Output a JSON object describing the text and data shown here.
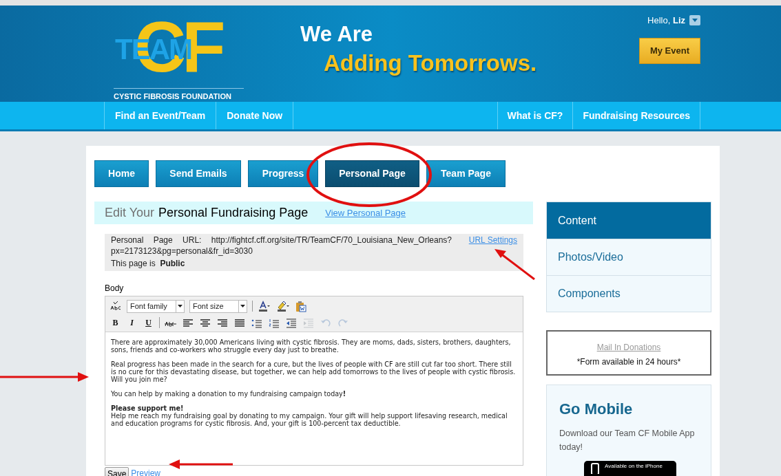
{
  "header": {
    "logo": {
      "team": "TEAM",
      "cf": "CF",
      "foundation": "CYSTIC FIBROSIS FOUNDATION"
    },
    "tagline_1": "We Are",
    "tagline_2": "Adding Tomorrows.",
    "greeting": "Hello,",
    "user": "Liz",
    "my_event_button": "My Event"
  },
  "nav": {
    "left": [
      "Find an Event/Team",
      "Donate Now"
    ],
    "right": [
      "What is CF?",
      "Fundraising Resources"
    ]
  },
  "tabs": [
    {
      "label": "Home",
      "selected": false,
      "circled": false
    },
    {
      "label": "Send Emails",
      "selected": false,
      "circled": false
    },
    {
      "label": "Progress",
      "selected": false,
      "circled": false
    },
    {
      "label": "Personal Page",
      "selected": true,
      "circled": true
    },
    {
      "label": "Team Page",
      "selected": false,
      "circled": false
    }
  ],
  "editor_page": {
    "heading_prefix": "Edit Your",
    "heading": "Personal Fundraising Page",
    "view_link": "View Personal Page",
    "url_label": "Personal Page URL:",
    "url": "http://fightcf.cff.org/site/TR/TeamCF/70_Louisiana_New_Orleans?px=2173123&pg=personal&fr_id=3030",
    "url_settings_link": "URL Settings",
    "url_settings_arrow": true,
    "body_arrow": true,
    "preview_arrow": true,
    "visibility_label": "This page is",
    "visibility": "Public",
    "body_label": "Body",
    "toolbar_1": [
      {
        "kind": "spellcheck",
        "disabled": false
      },
      {
        "kind": "select",
        "label": "Font family"
      },
      {
        "kind": "select",
        "label": "Font size"
      },
      {
        "kind": "separator"
      },
      {
        "kind": "font-color"
      },
      {
        "kind": "highlight"
      },
      {
        "kind": "paste-word"
      }
    ],
    "toolbar_2": [
      {
        "kind": "bold",
        "label": "B",
        "disabled": false
      },
      {
        "kind": "italic",
        "label": "I",
        "disabled": false
      },
      {
        "kind": "underline",
        "label": "U",
        "disabled": false
      },
      {
        "kind": "separator"
      },
      {
        "kind": "strikethrough",
        "disabled": false
      },
      {
        "kind": "align-left",
        "disabled": false
      },
      {
        "kind": "align-center",
        "disabled": false
      },
      {
        "kind": "align-right",
        "disabled": false
      },
      {
        "kind": "justify",
        "disabled": false
      },
      {
        "kind": "bullets",
        "disabled": false
      },
      {
        "kind": "numbers",
        "disabled": false
      },
      {
        "kind": "outdent",
        "disabled": false
      },
      {
        "kind": "indent",
        "disabled": true
      },
      {
        "kind": "undo",
        "disabled": true
      },
      {
        "kind": "redo",
        "disabled": true
      }
    ],
    "paragraphs": [
      "There are approximately 30,000 Americans living with cystic fibrosis. They are moms, dads, sisters, brothers, daughters, sons, friends and co-workers who struggle every day just to breathe.",
      "Real progress has been made in the search for a cure, but the lives of people with CF are still cut far too short. There still is no cure for this devastating disease, but together, we can help add tomorrows to the lives of people with cystic fibrosis. Will you join me?",
      "You can help by making a donation to my fundraising campaign today**!**",
      "**Please support me!**\nHelp me reach my fundraising goal by donating to my campaign. Your gift will help support lifesaving research, medical and education programs for cystic fibrosis. And, your gift is 100-percent tax deductible."
    ],
    "save_button": "Save",
    "preview_link": "Preview"
  },
  "sidebar": {
    "items": [
      {
        "label": "Content",
        "selected": true
      },
      {
        "label": "Photos/Video",
        "selected": false
      },
      {
        "label": "Components",
        "selected": false
      }
    ]
  },
  "mail_in": {
    "link": "Mail In Donations",
    "note": "*Form available in 24 hours*"
  },
  "mobile": {
    "title": "Go Mobile",
    "text": "Download our Team CF Mobile App today!",
    "badge": "Available on the iPhone"
  }
}
